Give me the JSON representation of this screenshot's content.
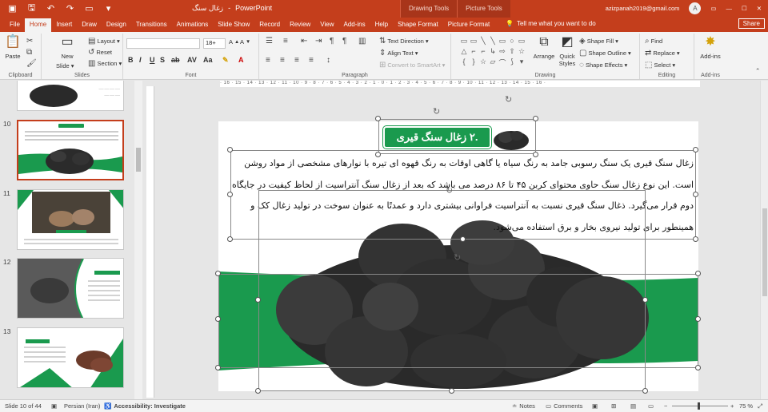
{
  "titlebar": {
    "doc_title": "زغال سنگ",
    "separator": "-",
    "app_name": "PowerPoint",
    "ctx_drawing": "Drawing Tools",
    "ctx_picture": "Picture Tools",
    "account": "azizpanah2019@gmail.com",
    "avatar_letter": "A"
  },
  "menu": {
    "tabs": [
      "File",
      "Home",
      "Insert",
      "Draw",
      "Design",
      "Transitions",
      "Animations",
      "Slide Show",
      "Record",
      "Review",
      "View",
      "Add-ins",
      "Help",
      "Shape Format",
      "Picture Format"
    ],
    "tell_me": "Tell me what you want to do",
    "share": "Share"
  },
  "ribbon": {
    "clipboard": {
      "label": "Clipboard",
      "paste": "Paste"
    },
    "slides": {
      "label": "Slides",
      "new_slide": "New\nSlide",
      "layout": "Layout",
      "reset": "Reset",
      "section": "Section"
    },
    "font": {
      "label": "Font",
      "size": "18+"
    },
    "paragraph": {
      "label": "Paragraph",
      "text_direction": "Text Direction",
      "align_text": "Align Text",
      "smartart": "Convert to SmartArt"
    },
    "drawing": {
      "label": "Drawing",
      "arrange": "Arrange",
      "quick_styles": "Quick\nStyles",
      "shape_fill": "Shape Fill",
      "shape_outline": "Shape Outline",
      "shape_effects": "Shape Effects"
    },
    "editing": {
      "label": "Editing",
      "find": "Find",
      "replace": "Replace",
      "select": "Select"
    },
    "addins": {
      "label": "Add-ins",
      "addins_btn": "Add-ins"
    }
  },
  "thumbnails": [
    {
      "num": "10",
      "selected": true
    },
    {
      "num": "11",
      "selected": false
    },
    {
      "num": "12",
      "selected": false
    },
    {
      "num": "13",
      "selected": false
    }
  ],
  "ruler": "· 16 · 15 · 14 · 13 · 12 · 11 · 10 · 9 · 8 · 7 · 6 · 5 · 4 · 3 · 2 · 1 · 0 · 1 · 2 · 3 · 4 · 5 · 6 · 7 · 8 · 9 · 10 · 11 · 12 · 13 · 14 · 15 · 16 ·",
  "slide": {
    "title": ".۲ زغال سنگ قیری",
    "body": "زغال سنگ قیری یک سنگ رسوبی جامد به رنگ سیاه یا گاهی اوقات به رنگ قهوه ای تیره با نوارهای مشخصی از مواد روشن است. این نوع زغال سنگ حاوی محتوای کربن  ۴۵ تا ۸۶ درصد می باشد که بعد از زغال سنگ آنتراسیت از لحاظ کیفیت در جایگاه دوم قرار می‌گیرد. ذغال سنگ قیری نسبت به آنتراسیت فراوانی بیشتری دارد و عمدتًا به عنوان سوخت در تولید زغال کک و همینطور برای تولید نیروی بخار و برق استفاده می‌شود."
  },
  "status": {
    "slide_of": "Slide 10 of 44",
    "language": "Persian (Iran)",
    "accessibility": "Accessibility: Investigate",
    "notes": "Notes",
    "comments": "Comments",
    "zoom": "75 %"
  },
  "colors": {
    "accent": "#c43e1c",
    "green": "#1a9a4e"
  }
}
